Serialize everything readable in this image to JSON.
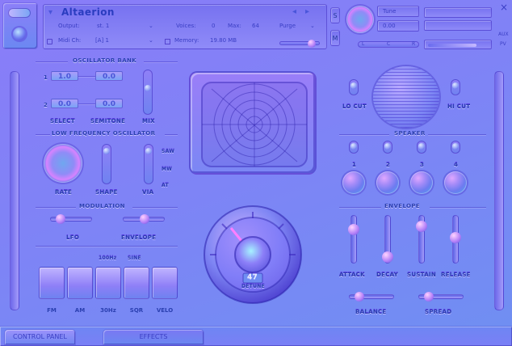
{
  "header": {
    "instrument_name": "Altaerion",
    "output_label": "Output:",
    "output_value": "st. 1",
    "midi_label": "Midi Ch:",
    "midi_value": "[A] 1",
    "voices_label": "Voices:",
    "voices_value": "0",
    "max_label": "Max:",
    "max_value": "64",
    "purge_label": "Purge",
    "memory_label": "Memory:",
    "memory_value": "19.80 MB",
    "tune_label": "Tune",
    "tune_value": "0.00",
    "s_label": "S",
    "m_label": "M",
    "aux_label": "AUX",
    "pv_label": "PV",
    "pan_left": "L",
    "pan_center": "C",
    "pan_right": "R",
    "nav_prev": "◂",
    "nav_next": "▸",
    "close": "×"
  },
  "oscillator_bank": {
    "title": "OSCILLATOR BANK",
    "row1": {
      "index": "1",
      "select": "1.0",
      "semitone": "0.0"
    },
    "row2": {
      "index": "2",
      "select": "0.0",
      "semitone": "0.0"
    },
    "select_label": "SELECT",
    "semitone_label": "SEMITONE",
    "mix_label": "MIX"
  },
  "lfo": {
    "title": "LOW FREQUENCY OSCILLATOR",
    "rate_label": "RATE",
    "shape_label": "SHAPE",
    "via_label": "VIA",
    "via_options": [
      "SAW",
      "MW",
      "AT"
    ]
  },
  "modulation": {
    "title": "MODULATION",
    "lfo_label": "LFO",
    "envelope_label": "ENVELOPE",
    "pad_labels": [
      "FM",
      "AM",
      "30Hz",
      "SQR",
      "VELO"
    ],
    "pad_top_labels": [
      "100Hz",
      "SINE"
    ]
  },
  "tuning": {
    "readout": "47",
    "detune_label": "DETUNE"
  },
  "filters": {
    "lo_cut_label": "LO CUT",
    "hi_cut_label": "HI CUT"
  },
  "speaker": {
    "title": "SPEAKER",
    "knob_labels": [
      "1",
      "2",
      "3",
      "4"
    ]
  },
  "envelope": {
    "title": "ENVELOPE",
    "attack_label": "ATTACK",
    "decay_label": "DECAY",
    "sustain_label": "SUSTAIN",
    "release_label": "RELEASE",
    "balance_label": "BALANCE",
    "spread_label": "SPREAD"
  },
  "tabs": {
    "control_panel": "CONTROL PANEL",
    "effects": "EFFECTS"
  },
  "colors": {
    "accent_pink": "#ff77ff",
    "accent_cyan": "#7ff0ff",
    "panel": "#8a78f7"
  },
  "icons": {
    "wrench": "wrench-icon",
    "gear": "gear-icon"
  }
}
